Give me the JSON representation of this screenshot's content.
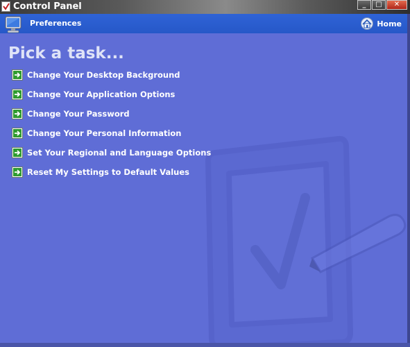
{
  "window": {
    "title": "Control Panel",
    "controls": {
      "minimize": "_",
      "maximize": "□",
      "close": "✕"
    }
  },
  "header": {
    "section_label": "Preferences",
    "home_label": "Home"
  },
  "main": {
    "heading": "Pick a task...",
    "tasks": [
      {
        "label": "Change Your Desktop Background",
        "icon": "green-arrow-icon"
      },
      {
        "label": "Change Your Application Options",
        "icon": "green-arrow-icon"
      },
      {
        "label": "Change Your Password",
        "icon": "green-arrow-icon"
      },
      {
        "label": "Change Your Personal Information",
        "icon": "green-arrow-icon"
      },
      {
        "label": "Set Your Regional and Language Options",
        "icon": "green-arrow-icon"
      },
      {
        "label": "Reset My Settings to Default Values",
        "icon": "green-arrow-icon"
      }
    ]
  },
  "colors": {
    "background": "#5f6dd6",
    "header_bar": "#2f63d6",
    "heading_text": "#dfe3f7",
    "task_text": "#ffffff",
    "arrow_green": "#2e9b2e"
  }
}
